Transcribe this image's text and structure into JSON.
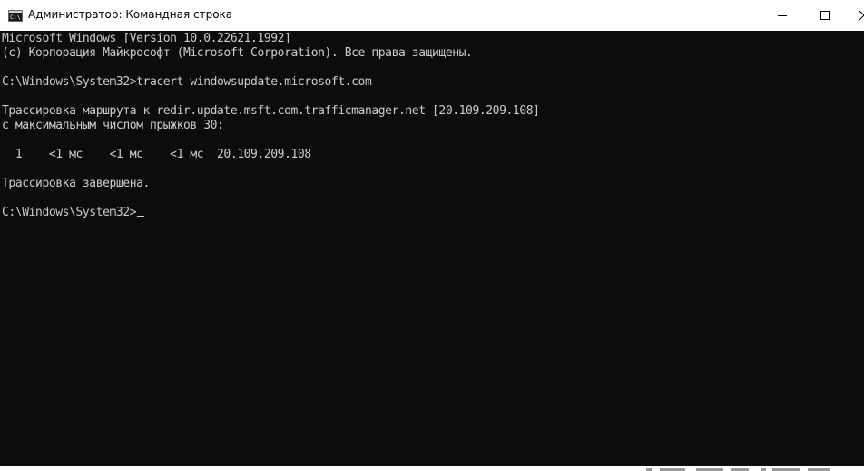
{
  "window": {
    "title": "Администратор: Командная строка",
    "icon": "cmd-icon"
  },
  "controls": {
    "minimize_icon": "minimize-icon",
    "maximize_icon": "maximize-icon",
    "close_icon": "close-icon"
  },
  "console": {
    "lines": [
      "Microsoft Windows [Version 10.0.22621.1992]",
      "(c) Корпорация Майкрософт (Microsoft Corporation). Все права защищены.",
      "",
      "C:\\Windows\\System32>tracert windowsupdate.microsoft.com",
      "",
      "Трассировка маршрута к redir.update.msft.com.trafficmanager.net [20.109.209.108]",
      "с максимальным числом прыжков 30:",
      "",
      "  1    <1 мс    <1 мс    <1 мс  20.109.209.108",
      "",
      "Трассировка завершена.",
      "",
      "C:\\Windows\\System32>"
    ]
  },
  "colors": {
    "console_background": "#0c0c0c",
    "console_text": "#cccccc",
    "titlebar_background": "#ffffff"
  }
}
